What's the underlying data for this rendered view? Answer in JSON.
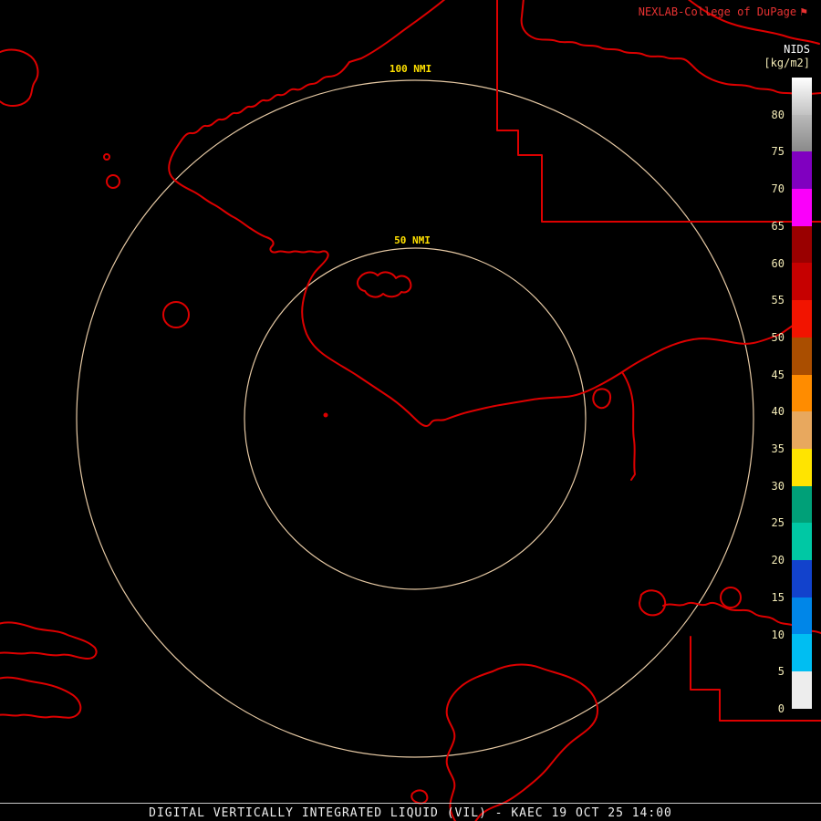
{
  "header": {
    "brand": "NEXLAB-College of DuPage",
    "brand_symbol": "⚑"
  },
  "colorbar": {
    "title": "NIDS",
    "units": "[kg/m2]",
    "segments": [
      {
        "tick": "80",
        "top": "#ffffff",
        "bottom": "#c2c2c2"
      },
      {
        "tick": "75",
        "top": "#bababa",
        "bottom": "#8a8a8a"
      },
      {
        "tick": "70",
        "top": "#8000c0",
        "bottom": "#8000c0"
      },
      {
        "tick": "65",
        "top": "#fa00fa",
        "bottom": "#fa00fa"
      },
      {
        "tick": "60",
        "top": "#9a0000",
        "bottom": "#9a0000"
      },
      {
        "tick": "55",
        "top": "#c60000",
        "bottom": "#c60000"
      },
      {
        "tick": "50",
        "top": "#f21400",
        "bottom": "#f21400"
      },
      {
        "tick": "45",
        "top": "#aa4e00",
        "bottom": "#aa4e00"
      },
      {
        "tick": "40",
        "top": "#ff8c00",
        "bottom": "#ff8c00"
      },
      {
        "tick": "35",
        "top": "#e8a85e",
        "bottom": "#e8a85e"
      },
      {
        "tick": "30",
        "top": "#ffe400",
        "bottom": "#ffe400"
      },
      {
        "tick": "25",
        "top": "#00a078",
        "bottom": "#00a078"
      },
      {
        "tick": "20",
        "top": "#00c8a4",
        "bottom": "#00c8a4"
      },
      {
        "tick": "15",
        "top": "#1242cc",
        "bottom": "#1242cc"
      },
      {
        "tick": "10",
        "top": "#0086e8",
        "bottom": "#0086e8"
      },
      {
        "tick": "5",
        "top": "#00bef2",
        "bottom": "#00bef2"
      },
      {
        "tick": "0",
        "top": "#ededed",
        "bottom": "#ededed"
      }
    ]
  },
  "rings": {
    "outer_label": "100 NMI",
    "inner_label": "50 NMI"
  },
  "footer": {
    "caption": "DIGITAL VERTICALLY INTEGRATED LIQUID (VIL) - KAEC 19 OCT 25 14:00"
  },
  "colors": {
    "map_outline": "#dd0000",
    "range_ring": "#e6c9a4",
    "brand": "#e83232",
    "tick_label": "#f2eab6",
    "ring_label": "#ffe000"
  }
}
